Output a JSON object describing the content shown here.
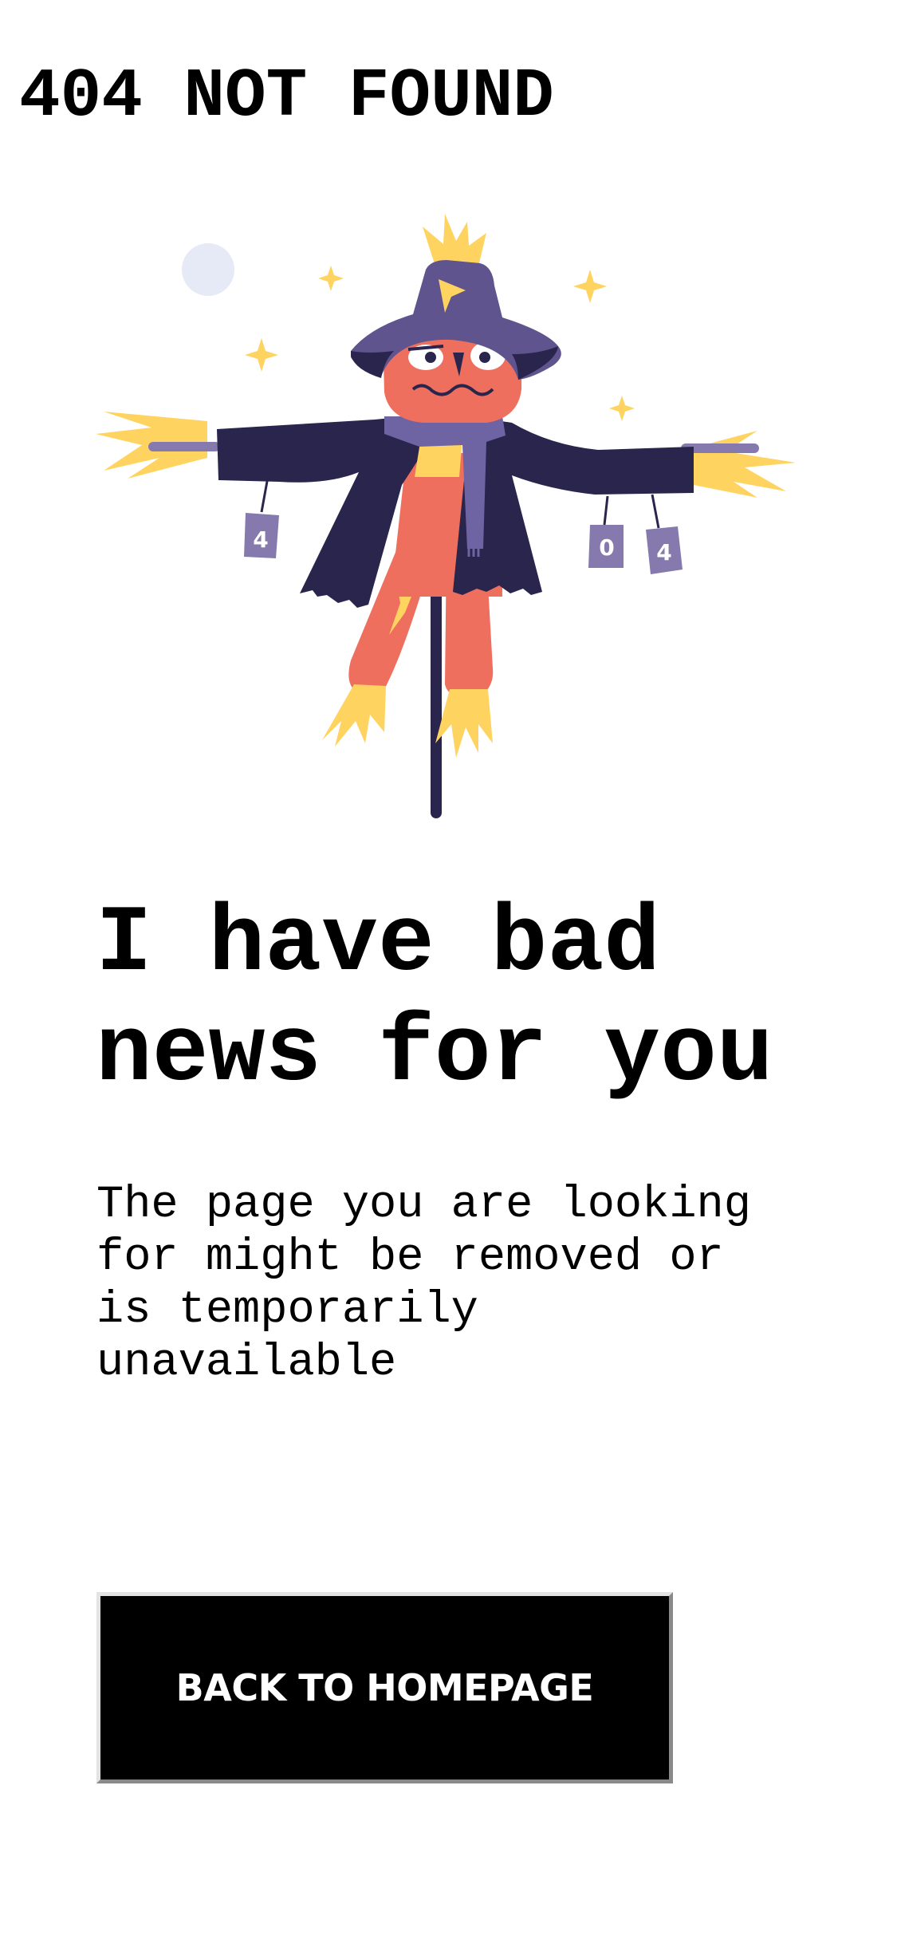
{
  "header": {
    "brand": "404 NOT FOUND"
  },
  "illustration": {
    "icon": "scarecrow-illustration",
    "can_labels": [
      "4",
      "0",
      "4"
    ],
    "colors": {
      "hat": "#5f548e",
      "coat": "#29254d",
      "face": "#ef6f5f",
      "straw": "#ffd35f",
      "scarf": "#6e64a3",
      "can": "#8579ad",
      "moon": "#e6e9f6",
      "sparkle": "#ffd35f"
    }
  },
  "main": {
    "headline": "I have bad news for you",
    "message": "The page you are looking for might be removed or is temporarily unavailable",
    "button_label": "BACK TO HOMEPAGE"
  },
  "colors": {
    "background": "#ffffff",
    "text": "#000000",
    "button_background": "#000000",
    "button_text": "#ffffff"
  }
}
